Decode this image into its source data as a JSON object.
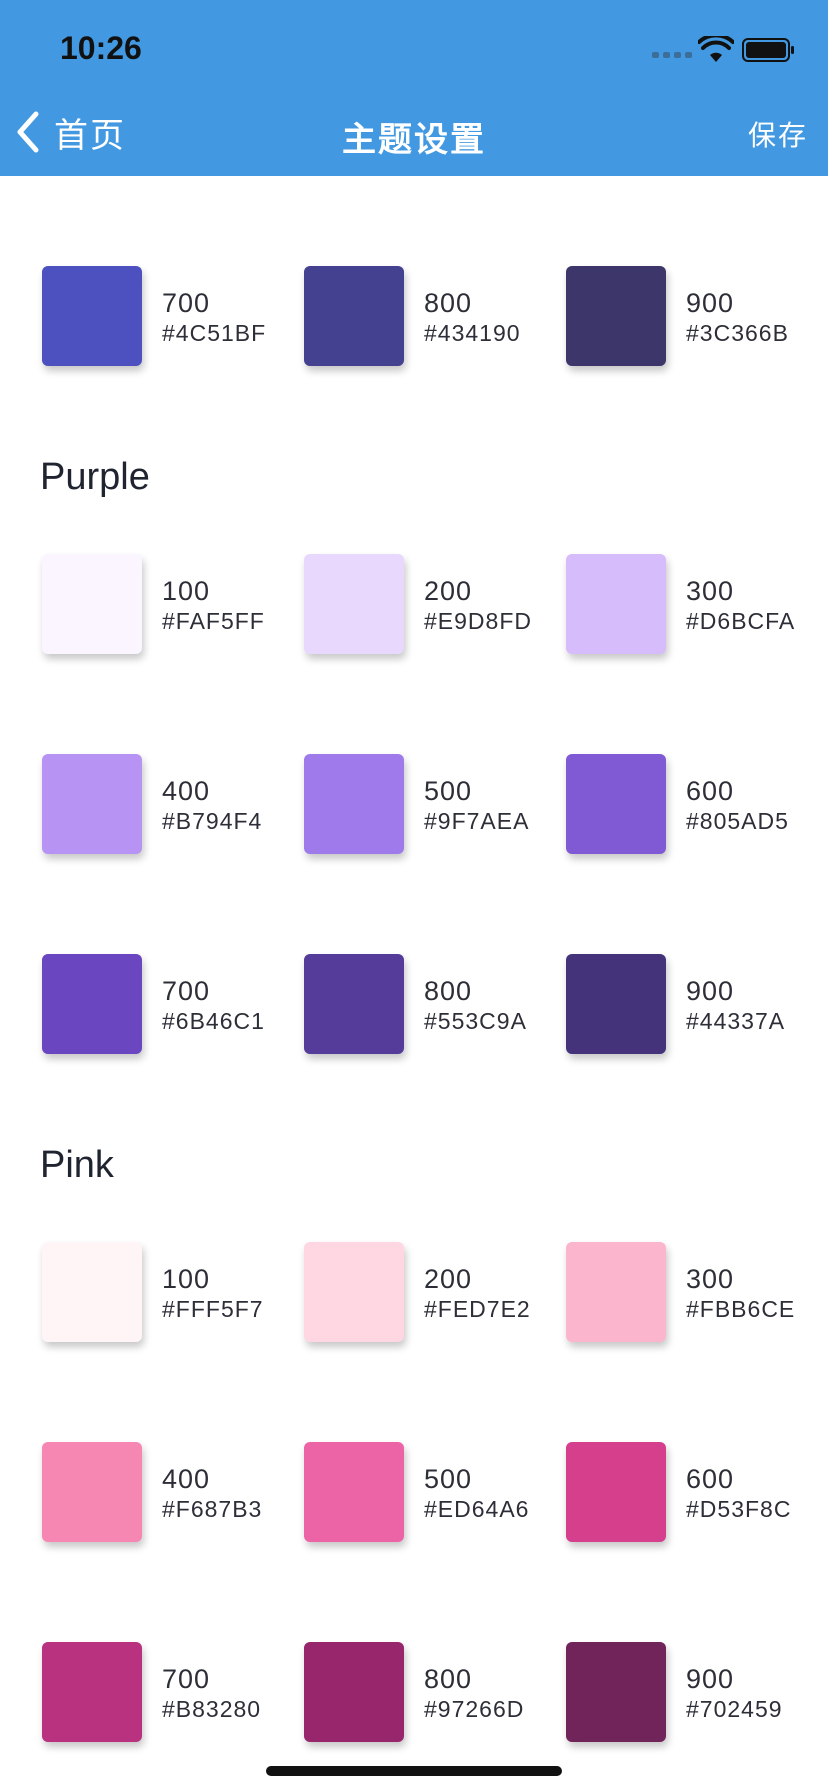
{
  "status": {
    "time": "10:26"
  },
  "nav": {
    "back_label": "首页",
    "title": "主题设置",
    "save_label": "保存"
  },
  "colors": {
    "header_bg": "#4299e1"
  },
  "top_row": [
    {
      "shade": "700",
      "hex": "#4C51BF"
    },
    {
      "shade": "800",
      "hex": "#434190"
    },
    {
      "shade": "900",
      "hex": "#3C366B"
    }
  ],
  "sections": [
    {
      "title": "Purple",
      "rows": [
        [
          {
            "shade": "100",
            "hex": "#FAF5FF"
          },
          {
            "shade": "200",
            "hex": "#E9D8FD"
          },
          {
            "shade": "300",
            "hex": "#D6BCFA"
          }
        ],
        [
          {
            "shade": "400",
            "hex": "#B794F4"
          },
          {
            "shade": "500",
            "hex": "#9F7AEA"
          },
          {
            "shade": "600",
            "hex": "#805AD5"
          }
        ],
        [
          {
            "shade": "700",
            "hex": "#6B46C1"
          },
          {
            "shade": "800",
            "hex": "#553C9A"
          },
          {
            "shade": "900",
            "hex": "#44337A"
          }
        ]
      ]
    },
    {
      "title": "Pink",
      "rows": [
        [
          {
            "shade": "100",
            "hex": "#FFF5F7"
          },
          {
            "shade": "200",
            "hex": "#FED7E2"
          },
          {
            "shade": "300",
            "hex": "#FBB6CE"
          }
        ],
        [
          {
            "shade": "400",
            "hex": "#F687B3"
          },
          {
            "shade": "500",
            "hex": "#ED64A6"
          },
          {
            "shade": "600",
            "hex": "#D53F8C"
          }
        ],
        [
          {
            "shade": "700",
            "hex": "#B83280"
          },
          {
            "shade": "800",
            "hex": "#97266D"
          },
          {
            "shade": "900",
            "hex": "#702459"
          }
        ]
      ]
    }
  ]
}
